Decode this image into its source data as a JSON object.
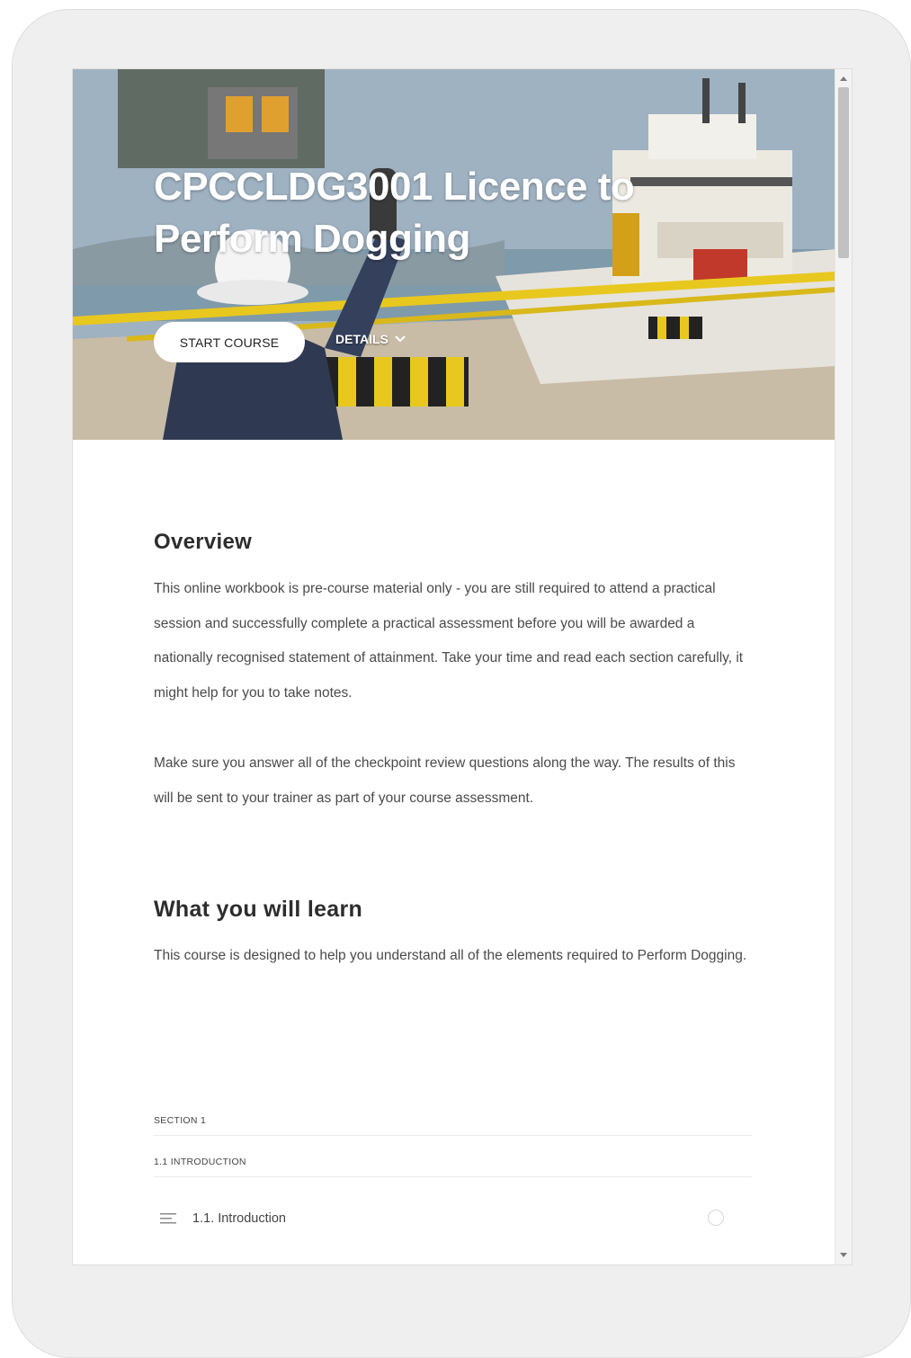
{
  "course": {
    "title": "CPCCLDG3001 Licence to Perform Dogging",
    "start_label": "START COURSE",
    "details_label": "DETAILS"
  },
  "overview": {
    "heading": "Overview",
    "paragraph": "This online workbook is pre-course material only - you are still required to attend a practical session and successfully complete a practical assessment before you will be awarded a nationally recognised statement of attainment. Take your time and read each section carefully, it might help for you to take notes.",
    "paragraph2": "Make sure you answer all of the checkpoint review questions along the way. The results of this will be sent to your trainer as part of your course assessment."
  },
  "learn": {
    "heading": "What you will learn",
    "paragraph": "This course is designed to help you understand all of the elements required to Perform Dogging."
  },
  "outline": {
    "section_label": "SECTION 1",
    "subsection_label": "1.1 INTRODUCTION",
    "lesson_label": "1.1. Introduction"
  },
  "icons": {
    "lesson": "text-lines-icon",
    "details": "chevron-down-icon",
    "status": "circle-outline-icon"
  },
  "colors": {
    "heading": "#2d2d2d",
    "body_text": "#4a4a4a",
    "button_bg": "#ffffff"
  }
}
